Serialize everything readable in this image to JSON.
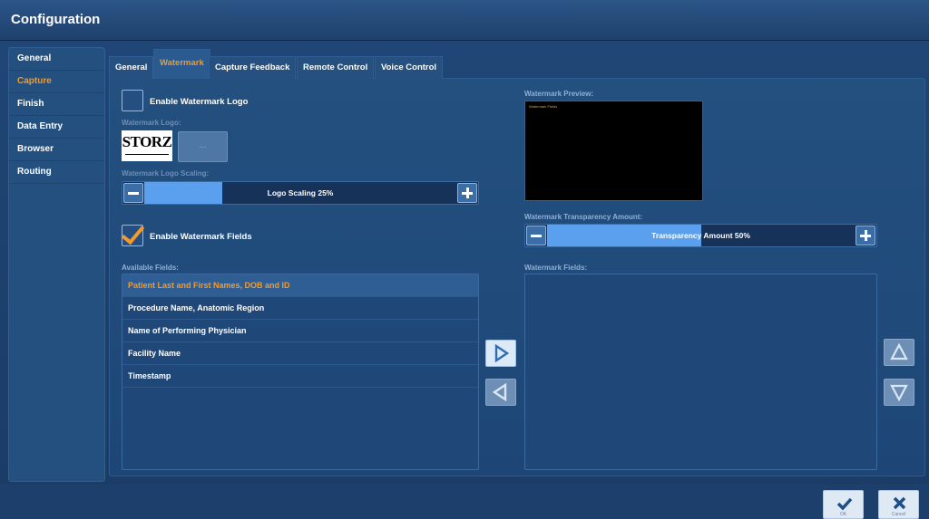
{
  "window": {
    "title": "Configuration"
  },
  "sidebar": {
    "items": [
      {
        "label": "General"
      },
      {
        "label": "Capture",
        "active": true
      },
      {
        "label": "Finish"
      },
      {
        "label": "Data Entry"
      },
      {
        "label": "Browser"
      },
      {
        "label": "Routing"
      }
    ]
  },
  "tabs": [
    {
      "label": "General"
    },
    {
      "label": "Watermark",
      "active": true
    },
    {
      "label": "Capture Feedback"
    },
    {
      "label": "Remote Control"
    },
    {
      "label": "Voice Control"
    }
  ],
  "watermark_logo": {
    "checkbox_label": "Enable Watermark Logo",
    "checked": false,
    "logo_label": "Watermark Logo:",
    "logo_text": "STORZ",
    "browse_label": "...",
    "scaling_label": "Watermark Logo Scaling:",
    "scaling_text": "Logo Scaling  25%",
    "scaling_value_percent": 25
  },
  "watermark_fields_toggle": {
    "checkbox_label": "Enable Watermark Fields",
    "checked": true
  },
  "available_fields": {
    "label": "Available Fields:",
    "items": [
      {
        "label": "Patient Last and First Names, DOB and ID",
        "selected": true
      },
      {
        "label": "Procedure Name, Anatomic Region"
      },
      {
        "label": "Name of Performing Physician"
      },
      {
        "label": "Facility Name"
      },
      {
        "label": "Timestamp"
      }
    ]
  },
  "preview": {
    "label": "Watermark Preview:",
    "sample_text": "Watermark Fields"
  },
  "transparency": {
    "label": "Watermark Transparency Amount:",
    "text": "Transparency Amount  50%",
    "value_percent": 50
  },
  "watermark_fields": {
    "label": "Watermark Fields:",
    "items": []
  },
  "footer": {
    "ok_label": "OK",
    "cancel_label": "Cancel"
  },
  "colors": {
    "accent": "#f39a2a",
    "background": "#1d3f6c",
    "slider_fill": "#5ba0ee"
  }
}
